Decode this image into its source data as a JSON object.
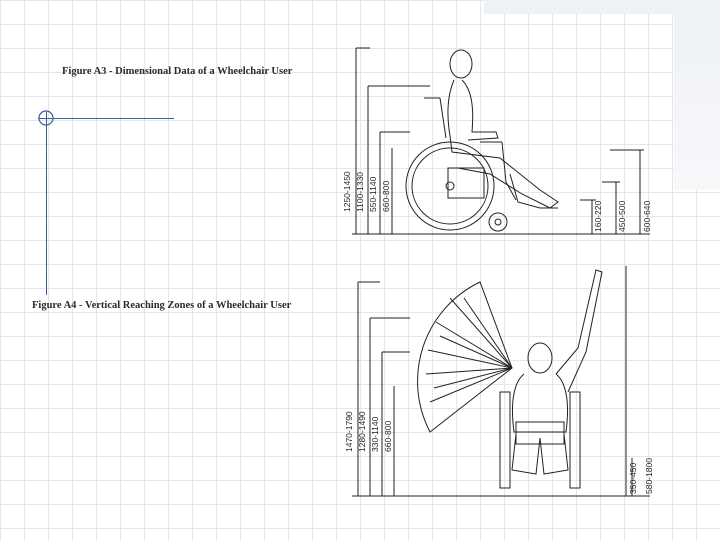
{
  "captions": {
    "figure_a3": "Figure A3 - Dimensional Data of a Wheelchair User",
    "figure_a4": "Figure A4 - Vertical Reaching Zones of a Wheelchair User"
  },
  "figure_a3_dimensions": {
    "d1": "1250-1450",
    "d2": "1100-1330",
    "d3": "550-1140",
    "d4": "660-800",
    "d5": "160-220",
    "d6": "450-500",
    "d7": "600-640"
  },
  "figure_a4_dimensions": {
    "d1": "1470-1790",
    "d2": "1280-1490",
    "d3": "330-1140",
    "d4": "660-800",
    "d5": "350-450",
    "d6": "580-1800"
  },
  "colors": {
    "accent_line": "#3d5e9c",
    "drawing": "#222222",
    "grid": "#e3e7ec"
  }
}
